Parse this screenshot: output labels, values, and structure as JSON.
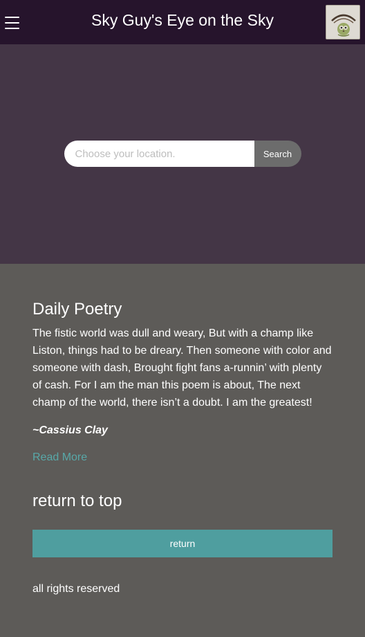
{
  "header": {
    "title": "Sky Guy's Eye on the Sky",
    "menu_icon": "hamburger-menu-icon",
    "logo": "owl-logo"
  },
  "search": {
    "placeholder": "Choose your location.",
    "button_label": "Search"
  },
  "poetry": {
    "heading": "Daily Poetry",
    "poem": "The fistic world was dull and weary, But with a champ like Liston, things had to be dreary. Then someone with color and someone with dash, Brought fight fans a-runnin’ with plenty of cash. For I am the man this poem is about, The next champ of the world, there isn’t a doubt. I am the greatest!",
    "author": "~Cassius Clay",
    "read_more": "Read More"
  },
  "return_section": {
    "heading": "return to top",
    "button_label": "return"
  },
  "footer": {
    "text": "all rights reserved"
  },
  "colors": {
    "navbar": "#26142c",
    "hero": "#443646",
    "body": "#5d5b58",
    "accent": "#4f9e9f",
    "link": "#58a8a8"
  }
}
